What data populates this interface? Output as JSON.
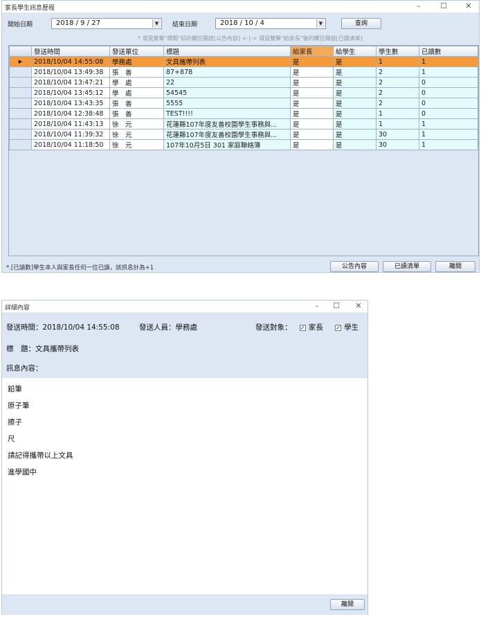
{
  "history_window": {
    "title": "家長學生訊息歷程",
    "start_label": "開始日期",
    "start_value": "2018 / 9 / 27",
    "end_label": "結束日期",
    "end_value": "2018 / 10 / 4",
    "query_button": "查詢",
    "hint": "* 滑鼠雙擊\"標題\"前的欄位開啟[公告內容]   <-|->   滑鼠雙擊\"給家長\"後的欄位開啟[已讀清單]",
    "columns": [
      "發送時間",
      "發送單位",
      "標題",
      "給家長",
      "給學生",
      "學生數",
      "已讀數"
    ],
    "rows": [
      {
        "time": "2018/10/04 14:55:08",
        "unit": "學務處",
        "title": "文具攜帶列表",
        "to_parent": "是",
        "to_student": "是",
        "students": "1",
        "read": "1"
      },
      {
        "time": "2018/10/04 13:49:38",
        "unit": "張　善",
        "title": "87+878",
        "to_parent": "是",
        "to_student": "是",
        "students": "2",
        "read": "1"
      },
      {
        "time": "2018/10/04 13:47:21",
        "unit": "學　處",
        "title": "22",
        "to_parent": "是",
        "to_student": "是",
        "students": "2",
        "read": "0"
      },
      {
        "time": "2018/10/04 13:45:12",
        "unit": "學　處",
        "title": "54545",
        "to_parent": "是",
        "to_student": "是",
        "students": "2",
        "read": "0"
      },
      {
        "time": "2018/10/04 13:43:35",
        "unit": "張　善",
        "title": "5555",
        "to_parent": "是",
        "to_student": "是",
        "students": "2",
        "read": "0"
      },
      {
        "time": "2018/10/04 12:38:48",
        "unit": "張　善",
        "title": "TEST!!!!",
        "to_parent": "是",
        "to_student": "是",
        "students": "1",
        "read": "0"
      },
      {
        "time": "2018/10/04 11:43:13",
        "unit": "徐　元",
        "title": "花蓮縣107年度友善校園學生事務與...",
        "to_parent": "是",
        "to_student": "是",
        "students": "1",
        "read": "1"
      },
      {
        "time": "2018/10/04 11:39:32",
        "unit": "徐　元",
        "title": "花蓮縣107年度友善校園學生事務與...",
        "to_parent": "是",
        "to_student": "是",
        "students": "30",
        "read": "1"
      },
      {
        "time": "2018/10/04 11:18:50",
        "unit": "徐　元",
        "title": "107年10月5日 301 家庭聯絡簿",
        "to_parent": "是",
        "to_student": "是",
        "students": "30",
        "read": "1"
      }
    ],
    "footer_note": "*.[已讀數]學生本人與家長任何一位已讀，該訊息計為+1",
    "announcement_button": "公告內容",
    "read_list_button": "已讀清單",
    "close_button": "離開"
  },
  "detail_window": {
    "title": "詳細內容",
    "send_time_label": "發送時間：",
    "send_time": "2018/10/04 14:55:08",
    "sender_label": "發送人員：",
    "sender": "學務處",
    "target_label": "發送對象：",
    "target_parent": "家長",
    "target_student": "學生",
    "subject_label": "標　題：",
    "subject": "文具攜帶列表",
    "content_label": "訊息內容：",
    "content_lines": [
      "鉛筆",
      "原子筆",
      "擦子",
      "尺",
      "請記得攜帶以上文具",
      "進學國中"
    ],
    "close_button": "離開"
  },
  "colors": {
    "selected_row": "#f49a3a",
    "highlight_header": "#f5a95a",
    "cell_cyan": "#e3fbfb",
    "window_bg": "#dde6f3"
  }
}
